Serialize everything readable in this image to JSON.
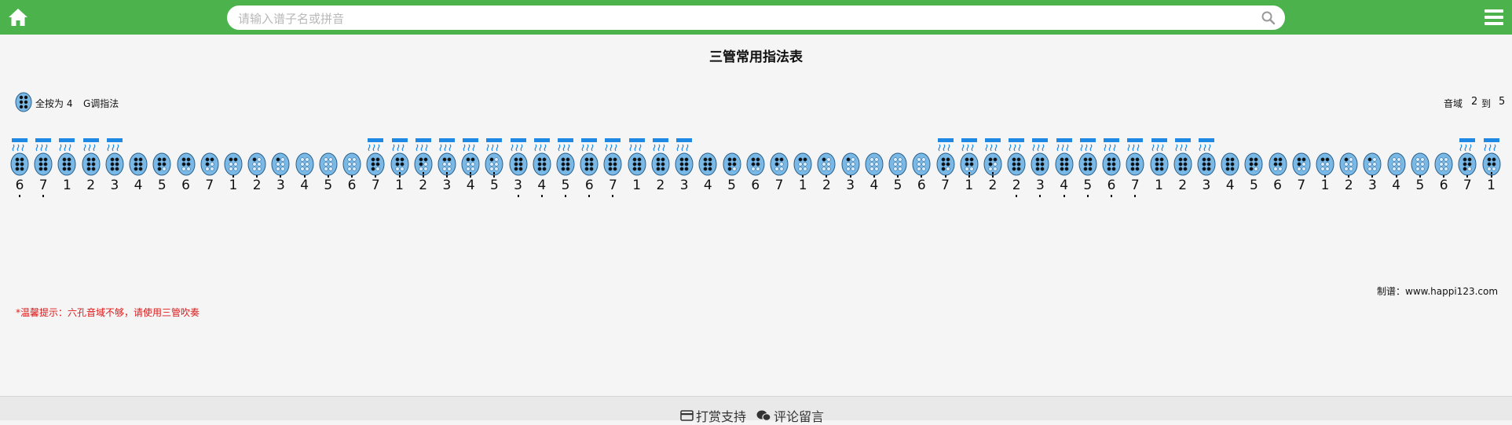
{
  "header": {
    "search_placeholder": "请输入谱子名或拼音"
  },
  "page": {
    "title": "三管常用指法表"
  },
  "legend": {
    "text": "全按为 4",
    "key": "G调指法"
  },
  "range": {
    "label": "音域",
    "from": "2",
    "to": "到",
    "end": "5"
  },
  "notes": [
    {
      "n": "6",
      "o": -1,
      "blow": true,
      "f": 6
    },
    {
      "n": "7",
      "o": -1,
      "blow": true,
      "f": 6
    },
    {
      "n": "1",
      "o": 0,
      "blow": true,
      "f": 6
    },
    {
      "n": "2",
      "o": 0,
      "blow": true,
      "f": 6
    },
    {
      "n": "3",
      "o": 0,
      "blow": true,
      "f": 6
    },
    {
      "n": "4",
      "o": 0,
      "blow": false,
      "f": 6
    },
    {
      "n": "5",
      "o": 0,
      "blow": false,
      "f": 5
    },
    {
      "n": "6",
      "o": 0,
      "blow": false,
      "f": 4
    },
    {
      "n": "7",
      "o": 0,
      "blow": false,
      "f": 3
    },
    {
      "n": "1",
      "o": 1,
      "blow": false,
      "f": 2
    },
    {
      "n": "2",
      "o": 1,
      "blow": false,
      "f": 1
    },
    {
      "n": "3",
      "o": 1,
      "blow": false,
      "f": 1
    },
    {
      "n": "4",
      "o": 1,
      "blow": false,
      "f": 0
    },
    {
      "n": "5",
      "o": 1,
      "blow": false,
      "f": 0
    },
    {
      "n": "6",
      "o": 1,
      "blow": false,
      "f": 0
    },
    {
      "n": "7",
      "o": 1,
      "blow": true,
      "f": 5
    },
    {
      "n": "1",
      "o": 2,
      "blow": true,
      "f": 4
    },
    {
      "n": "2",
      "o": 2,
      "blow": true,
      "f": 3
    },
    {
      "n": "3",
      "o": 2,
      "blow": true,
      "f": 2
    },
    {
      "n": "4",
      "o": 2,
      "blow": true,
      "f": 2
    },
    {
      "n": "5",
      "o": 2,
      "blow": true,
      "f": 1
    },
    {
      "n": "3",
      "o": -1,
      "blow": true,
      "f": 6
    },
    {
      "n": "4",
      "o": -1,
      "blow": true,
      "f": 6
    },
    {
      "n": "5",
      "o": -1,
      "blow": true,
      "f": 6
    },
    {
      "n": "6",
      "o": -1,
      "blow": true,
      "f": 6
    },
    {
      "n": "7",
      "o": -1,
      "blow": true,
      "f": 6
    },
    {
      "n": "1",
      "o": 0,
      "blow": true,
      "f": 6
    },
    {
      "n": "2",
      "o": 0,
      "blow": true,
      "f": 6
    },
    {
      "n": "3",
      "o": 0,
      "blow": true,
      "f": 6
    },
    {
      "n": "4",
      "o": 0,
      "blow": false,
      "f": 6
    },
    {
      "n": "5",
      "o": 0,
      "blow": false,
      "f": 5
    },
    {
      "n": "6",
      "o": 0,
      "blow": false,
      "f": 4
    },
    {
      "n": "7",
      "o": 0,
      "blow": false,
      "f": 3
    },
    {
      "n": "1",
      "o": 1,
      "blow": false,
      "f": 2
    },
    {
      "n": "2",
      "o": 1,
      "blow": false,
      "f": 1
    },
    {
      "n": "3",
      "o": 1,
      "blow": false,
      "f": 1
    },
    {
      "n": "4",
      "o": 1,
      "blow": false,
      "f": 0
    },
    {
      "n": "5",
      "o": 1,
      "blow": false,
      "f": 0
    },
    {
      "n": "6",
      "o": 1,
      "blow": false,
      "f": 0
    },
    {
      "n": "7",
      "o": 1,
      "blow": true,
      "f": 5
    },
    {
      "n": "1",
      "o": 2,
      "blow": true,
      "f": 4
    },
    {
      "n": "2",
      "o": 2,
      "blow": true,
      "f": 3
    },
    {
      "n": "2",
      "o": -1,
      "blow": true,
      "f": 6
    },
    {
      "n": "3",
      "o": -1,
      "blow": true,
      "f": 6
    },
    {
      "n": "4",
      "o": -1,
      "blow": true,
      "f": 6
    },
    {
      "n": "5",
      "o": -1,
      "blow": true,
      "f": 6
    },
    {
      "n": "6",
      "o": -1,
      "blow": true,
      "f": 6
    },
    {
      "n": "7",
      "o": -1,
      "blow": true,
      "f": 6
    },
    {
      "n": "1",
      "o": 0,
      "blow": true,
      "f": 6
    },
    {
      "n": "2",
      "o": 0,
      "blow": true,
      "f": 6
    },
    {
      "n": "3",
      "o": 0,
      "blow": true,
      "f": 6
    },
    {
      "n": "4",
      "o": 0,
      "blow": false,
      "f": 6
    },
    {
      "n": "5",
      "o": 0,
      "blow": false,
      "f": 5
    },
    {
      "n": "6",
      "o": 0,
      "blow": false,
      "f": 4
    },
    {
      "n": "7",
      "o": 0,
      "blow": false,
      "f": 3
    },
    {
      "n": "1",
      "o": 1,
      "blow": false,
      "f": 2
    },
    {
      "n": "2",
      "o": 1,
      "blow": false,
      "f": 1
    },
    {
      "n": "3",
      "o": 1,
      "blow": false,
      "f": 1
    },
    {
      "n": "4",
      "o": 1,
      "blow": false,
      "f": 0
    },
    {
      "n": "5",
      "o": 1,
      "blow": false,
      "f": 0
    },
    {
      "n": "6",
      "o": 1,
      "blow": false,
      "f": 0
    },
    {
      "n": "7",
      "o": 1,
      "blow": true,
      "f": 5
    },
    {
      "n": "1",
      "o": 2,
      "blow": true,
      "f": 4
    }
  ],
  "credit": "制谱：www.happi123.com",
  "tip": "*温馨提示：六孔音域不够，请使用三管吹奏",
  "footer": {
    "reward": "打赏支持",
    "comment": "评论留言"
  },
  "colors": {
    "header": "#4cb34c",
    "icon_blue": "#7ab8e6",
    "blow_blue": "#1e88e5",
    "tip_red": "#e01818"
  }
}
